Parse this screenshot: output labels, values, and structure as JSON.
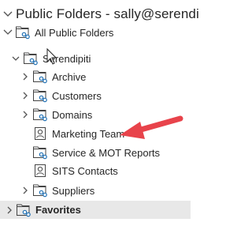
{
  "header": {
    "title": "Public Folders - sally@serendi"
  },
  "all_public_folders": {
    "label": "All Public Folders"
  },
  "root": {
    "label": "Serendipiti"
  },
  "items": [
    {
      "label": "Archive",
      "icon": "public-folder-icon",
      "expandable": true
    },
    {
      "label": "Customers",
      "icon": "public-folder-icon",
      "expandable": true
    },
    {
      "label": "Domains",
      "icon": "public-folder-icon",
      "expandable": true
    },
    {
      "label": "Marketing Team",
      "icon": "contact-folder-icon",
      "expandable": false
    },
    {
      "label": "Service & MOT Reports",
      "icon": "public-folder-icon",
      "expandable": false
    },
    {
      "label": "SITS Contacts",
      "icon": "contact-folder-icon",
      "expandable": false
    },
    {
      "label": "Suppliers",
      "icon": "public-folder-icon",
      "expandable": true
    }
  ],
  "favorites": {
    "label": "Favorites"
  },
  "colors": {
    "arrow": "#e8434b",
    "folder_blue": "#1f6fb3",
    "favorites_bg": "#e8e8e8"
  }
}
